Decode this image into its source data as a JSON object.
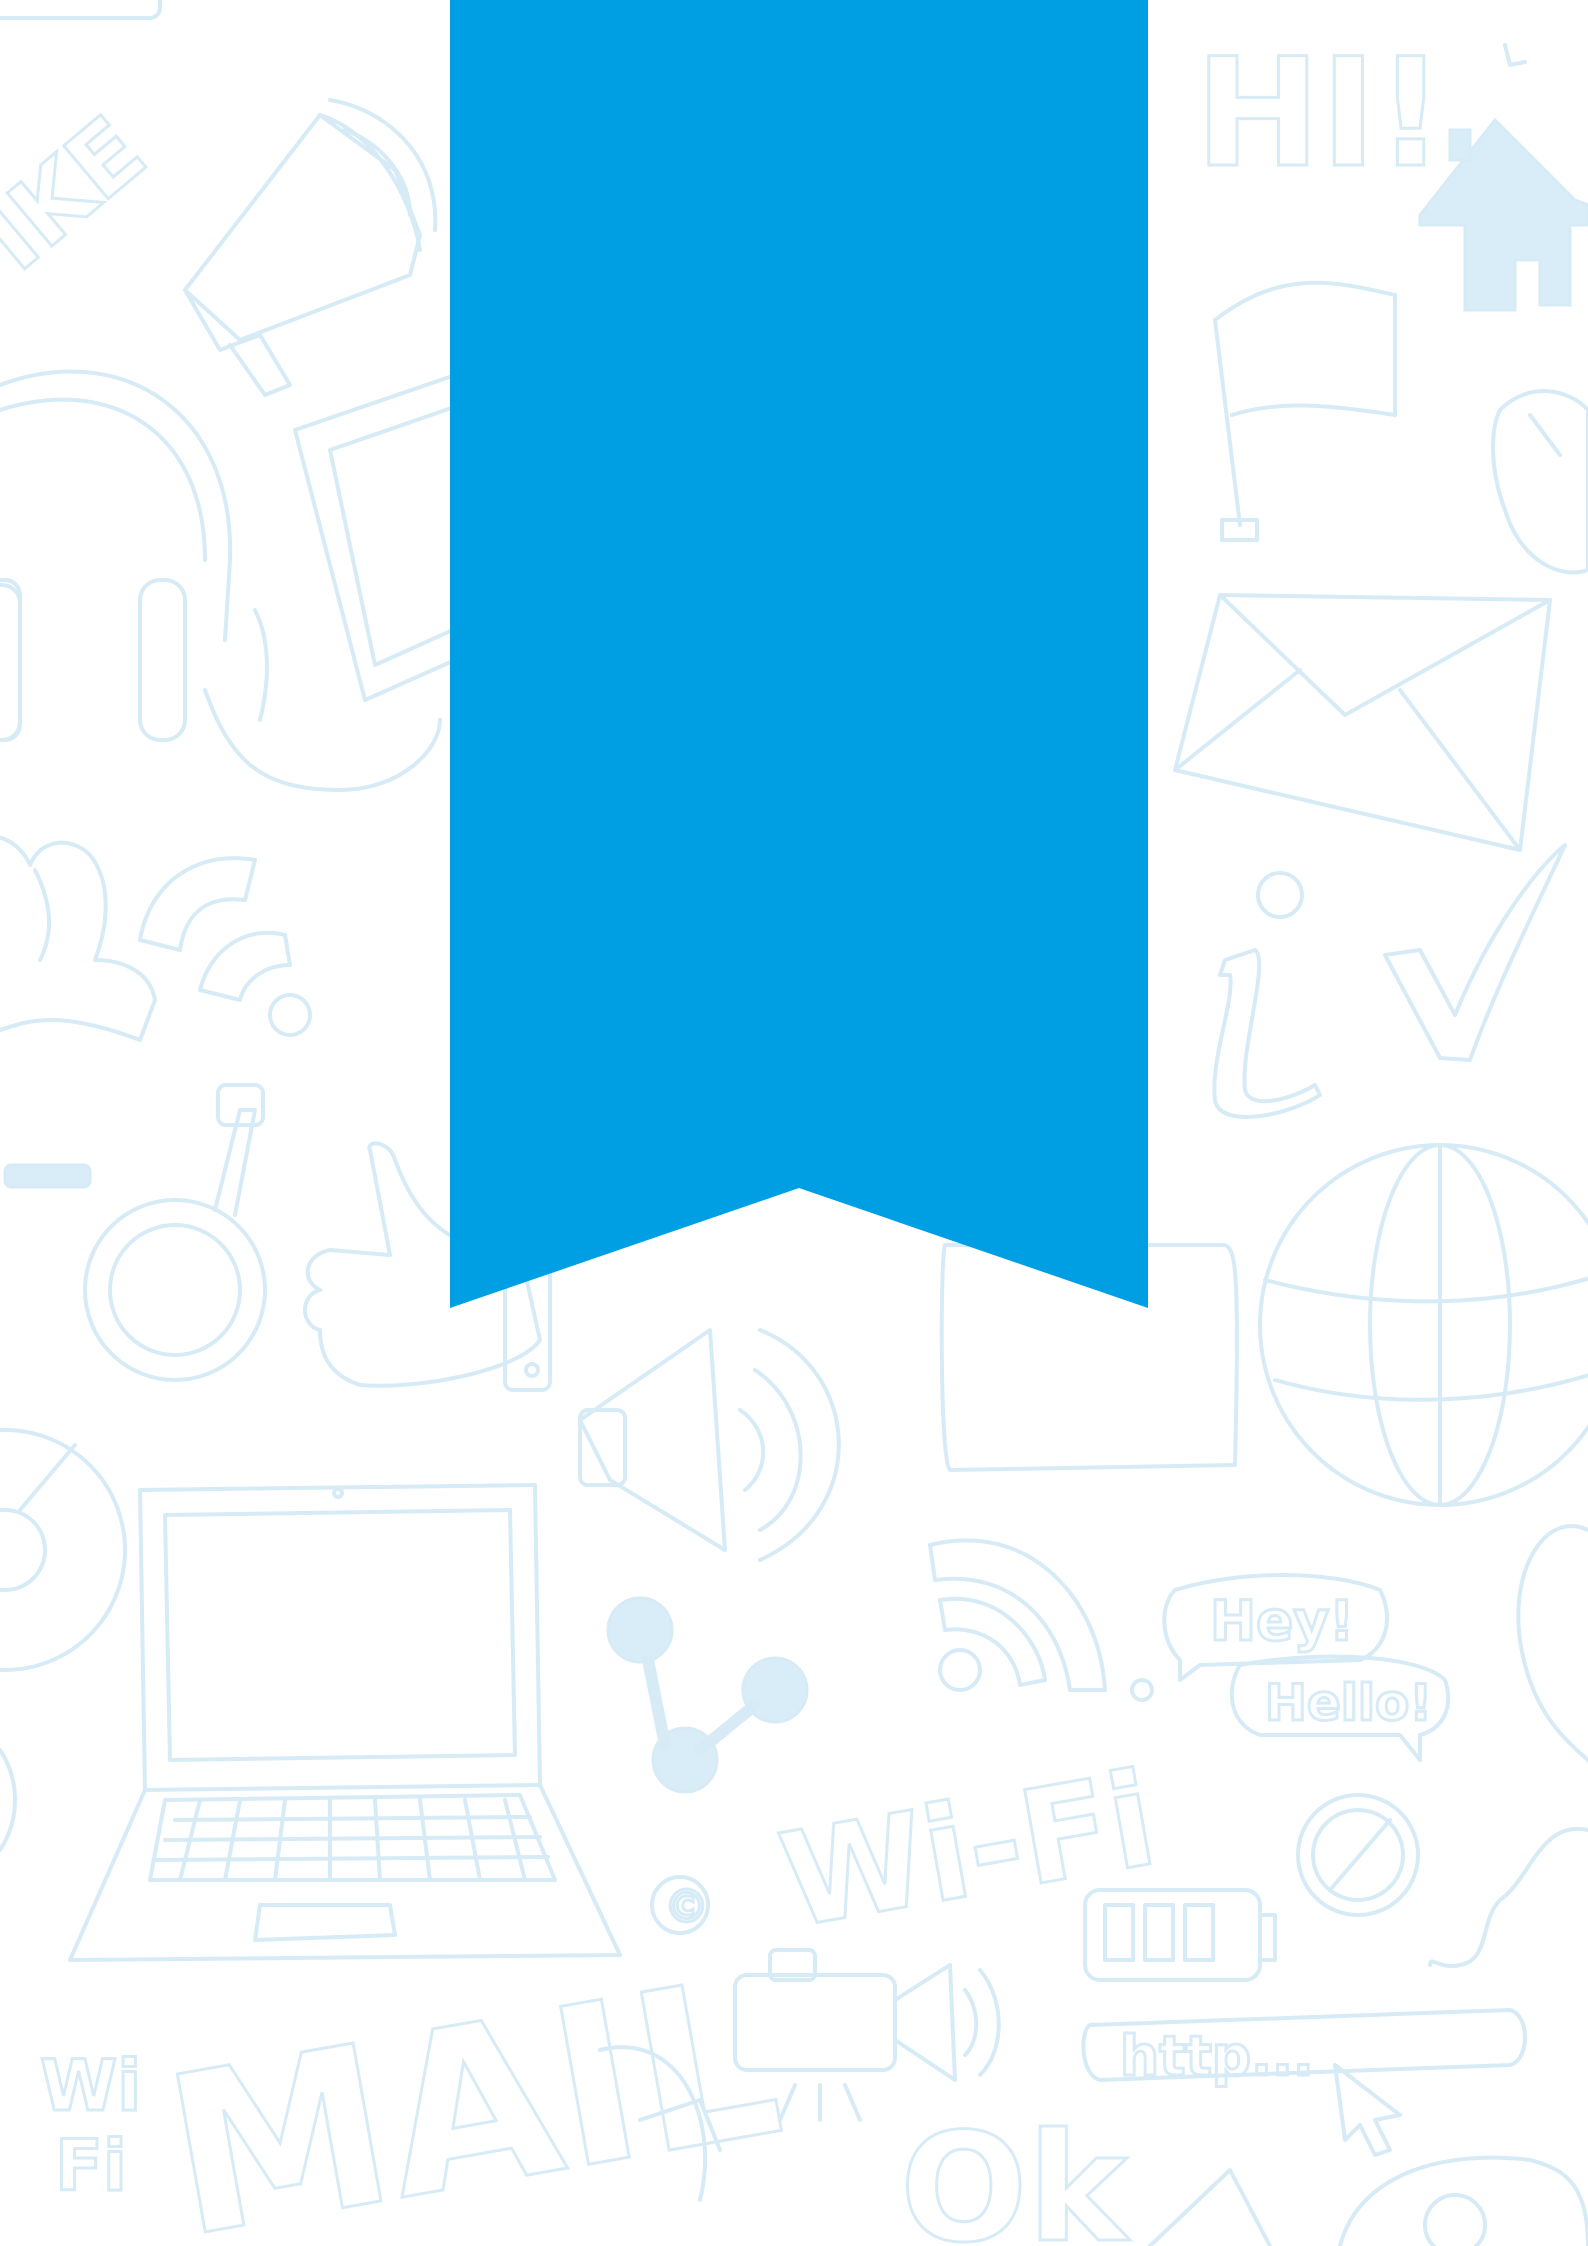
{
  "background": {
    "color": "#ffffff",
    "doodle_color": "#d6ebf6",
    "doodle_texts": {
      "hi": "HI!",
      "hey": "Hey!",
      "hello": "Hello!",
      "wifi": "Wi-Fi",
      "http": "http...",
      "mail": "MAIL",
      "ok": "Ok",
      "wifi_small_w": "Wi",
      "wifi_small_f": "Fi",
      "like": "IKE",
      "copyright": "©"
    },
    "doodle_icons": [
      "megaphone-icon",
      "house-icon",
      "flag-icon",
      "headphones-icon",
      "tablet-icon",
      "computer-mouse-icon",
      "envelope-icon",
      "info-icon",
      "checkmark-icon",
      "user-icon",
      "wifi-signal-icon",
      "magnifier-icon",
      "thumbs-up-icon",
      "globe-icon",
      "speaker-icon",
      "laptop-icon",
      "share-icon",
      "battery-icon",
      "no-sign-icon",
      "video-camera-icon",
      "cursor-icon",
      "speech-bubble-icon",
      "cd-icon"
    ]
  },
  "ribbon": {
    "color": "#009fe3"
  }
}
